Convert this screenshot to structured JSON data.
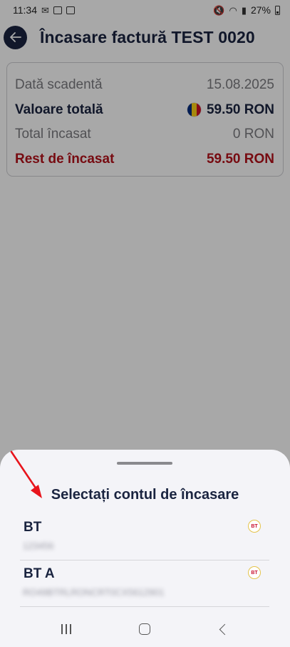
{
  "status_bar": {
    "time": "11:34",
    "battery": "27%"
  },
  "header": {
    "title": "Încasare factură TEST 0020",
    "back_icon": "arrow-left-icon"
  },
  "summary": {
    "rows": [
      {
        "label": "Dată scadentă",
        "value": "15.08.2025"
      },
      {
        "label": "Valoare totală",
        "value": "59.50 RON",
        "flag": "romania-flag-icon"
      },
      {
        "label": "Total încasat",
        "value": "0 RON"
      },
      {
        "label": "Rest de încasat",
        "value": "59.50 RON"
      }
    ]
  },
  "bottom_sheet": {
    "title": "Selectați contul de încasare",
    "accounts": [
      {
        "name": "BT",
        "iban": "123456",
        "logo": "BT"
      },
      {
        "name": "BT A",
        "iban": "RO49BTRLRONCRT0CX5612901",
        "logo": "BT"
      }
    ]
  },
  "colors": {
    "primary": "#1a2440",
    "danger": "#b5121b",
    "muted": "#7b7b80",
    "annotation": "#e8141c"
  }
}
